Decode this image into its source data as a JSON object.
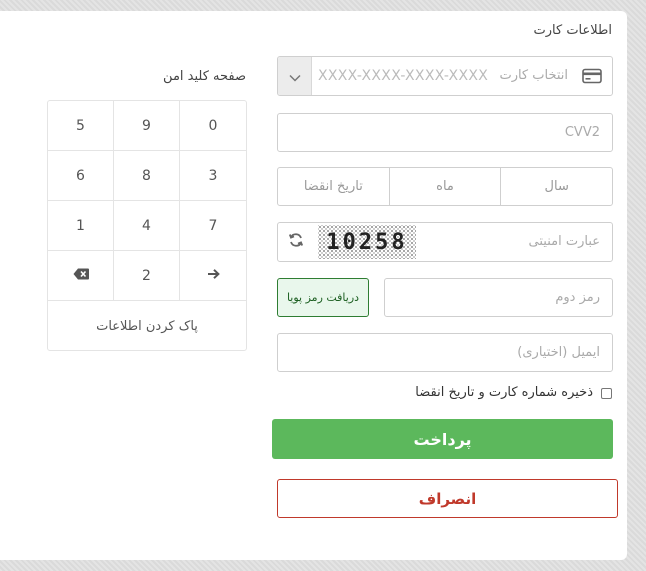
{
  "card_section": {
    "title": "اطلاعات کارت",
    "card_select_label": "انتخاب کارت",
    "card_number_placeholder": "XXXX-XXXX-XXXX-XXXX",
    "cvv2_placeholder": "CVV2",
    "expiry_label": "تاریخ انقضا",
    "month_placeholder": "ماه",
    "year_placeholder": "سال",
    "captcha_placeholder": "عبارت امنیتی",
    "captcha_code": "10258",
    "second_password_placeholder": "رمز دوم",
    "otp_button": "دریافت رمز پویا",
    "email_placeholder": "ایمیل (اختیاری)",
    "save_checkbox_label": "ذخیره شماره کارت و تاریخ انقضا",
    "pay_button": "پرداخت",
    "cancel_button": "انصراف"
  },
  "keypad": {
    "title": "صفحه کلید امن",
    "rows": [
      [
        "5",
        "9",
        "0"
      ],
      [
        "6",
        "8",
        "3"
      ],
      [
        "1",
        "4",
        "7"
      ]
    ],
    "row4_middle": "2",
    "clear_label": "پاک کردن اطلاعات",
    "icons": {
      "backspace": "backspace-icon",
      "next": "arrow-right-icon"
    }
  },
  "colors": {
    "pay": "#5cb85c",
    "cancel": "#c0392b",
    "otp_border": "#2e7d32",
    "otp_bg": "#e9f7ec"
  }
}
